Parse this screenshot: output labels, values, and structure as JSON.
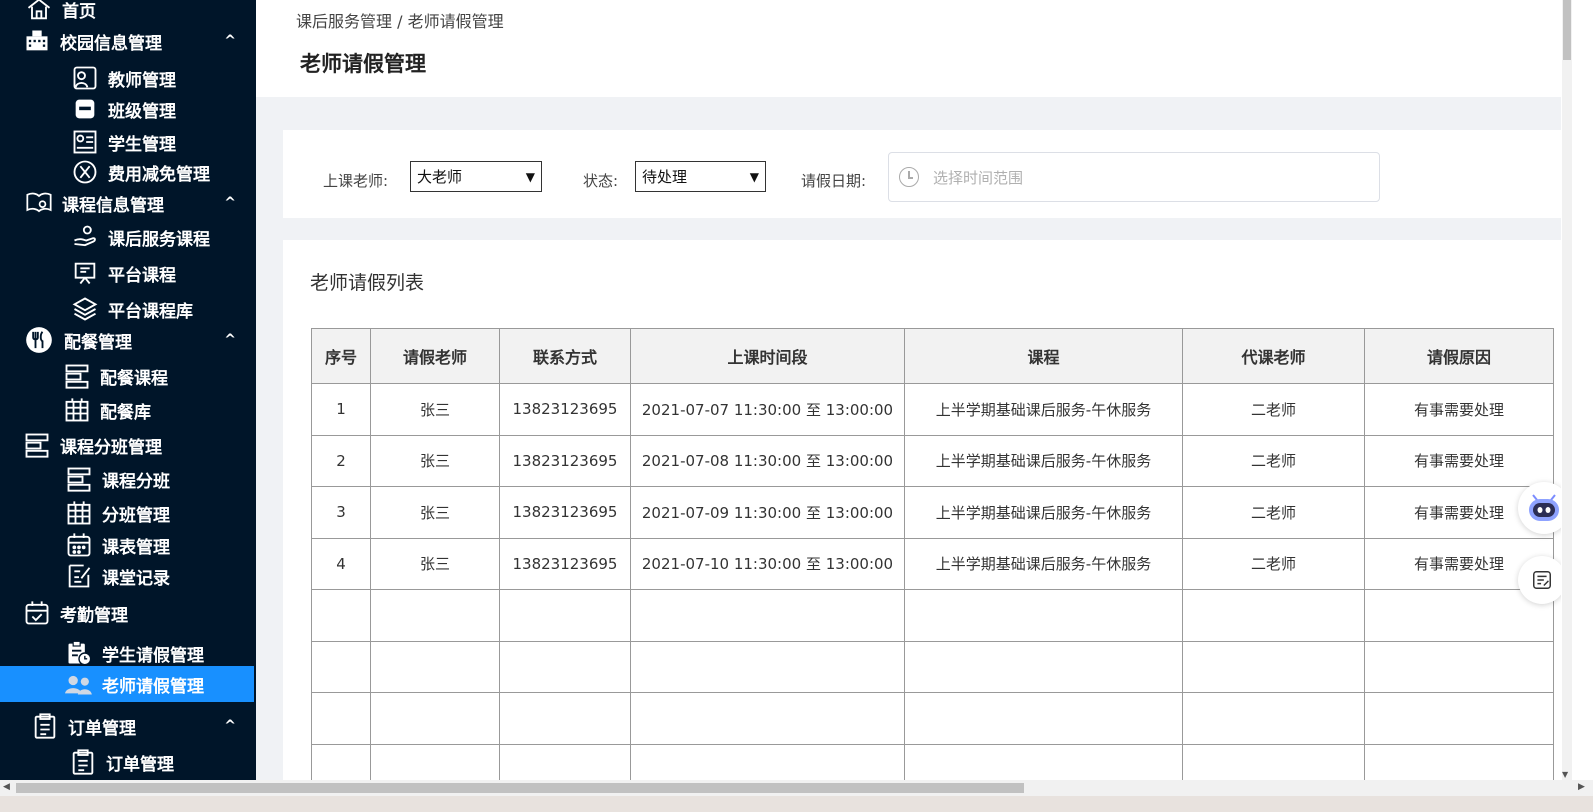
{
  "sidebar": {
    "home": "首页",
    "campus": "校园信息管理",
    "teacher_mgmt": "教师管理",
    "class_mgmt": "班级管理",
    "student_mgmt": "学生管理",
    "fee_mgmt": "费用减免管理",
    "course_info": "课程信息管理",
    "after_course": "课后服务课程",
    "platform_course": "平台课程",
    "platform_library": "平台课程库",
    "meal_mgmt": "配餐管理",
    "meal_course": "配餐课程",
    "meal_library": "配餐库",
    "class_split": "课程分班管理",
    "course_split": "课程分班",
    "split_mgmt": "分班管理",
    "schedule_mgmt": "课表管理",
    "class_record": "课堂记录",
    "attendance": "考勤管理",
    "student_leave": "学生请假管理",
    "teacher_leave": "老师请假管理",
    "order_group": "订单管理",
    "order_mgmt": "订单管理",
    "caret": "^"
  },
  "header": {
    "breadcrumb": "课后服务管理 / 老师请假管理",
    "title": "老师请假管理"
  },
  "filters": {
    "teacher_label": "上课老师:",
    "teacher_value": "大老师",
    "status_label": "状态:",
    "status_value": "待处理",
    "date_label": "请假日期:",
    "date_placeholder": "选择时间范围"
  },
  "list": {
    "title": "老师请假列表",
    "columns": [
      "序号",
      "请假老师",
      "联系方式",
      "上课时间段",
      "课程",
      "代课老师",
      "请假原因"
    ],
    "rows": [
      [
        "1",
        "张三",
        "13823123695",
        "2021-07-07 11:30:00 至 13:00:00",
        "上半学期基础课后服务-午休服务",
        "二老师",
        "有事需要处理"
      ],
      [
        "2",
        "张三",
        "13823123695",
        "2021-07-08 11:30:00 至 13:00:00",
        "上半学期基础课后服务-午休服务",
        "二老师",
        "有事需要处理"
      ],
      [
        "3",
        "张三",
        "13823123695",
        "2021-07-09 11:30:00 至 13:00:00",
        "上半学期基础课后服务-午休服务",
        "二老师",
        "有事需要处理"
      ],
      [
        "4",
        "张三",
        "13823123695",
        "2021-07-10 11:30:00 至 13:00:00",
        "上半学期基础课后服务-午休服务",
        "二老师",
        "有事需要处理"
      ]
    ]
  },
  "colors": {
    "sidebar_bg": "#001529",
    "active_bg": "#1890ff"
  }
}
